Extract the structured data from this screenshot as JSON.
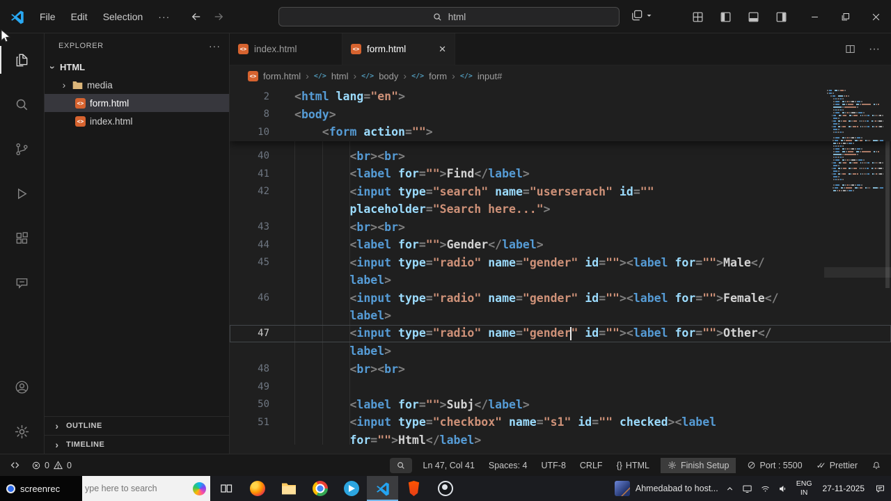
{
  "titlebar": {
    "menus": [
      "File",
      "Edit",
      "Selection"
    ],
    "more": "···",
    "search_value": "html"
  },
  "tabs": {
    "tab1": "index.html",
    "tab2": "form.html"
  },
  "breadcrumb": {
    "file": "form.html",
    "seg1": "html",
    "seg2": "body",
    "seg3": "form",
    "seg4": "input#"
  },
  "explorer": {
    "title": "EXPLORER",
    "more": "···",
    "root": "HTML",
    "folder1": "media",
    "file1": "form.html",
    "file2": "index.html",
    "outline": "OUTLINE",
    "timeline": "TIMELINE"
  },
  "icons": {
    "chevron": "›",
    "more": "···",
    "html_glyph": "<>",
    "braces": "{}",
    "checks": "✓✓"
  },
  "editor": {
    "sticky_rows": [
      {
        "n": "2",
        "t": [
          [
            "p",
            "<"
          ],
          [
            "tag",
            "html"
          ],
          [
            "ws",
            " "
          ],
          [
            "attr",
            "lang"
          ],
          [
            "p",
            "="
          ],
          [
            "str",
            "\"en\""
          ],
          [
            "p",
            ">"
          ]
        ]
      },
      {
        "n": "8",
        "t": [
          [
            "p",
            "<"
          ],
          [
            "tag",
            "body"
          ],
          [
            "p",
            ">"
          ]
        ]
      },
      {
        "n": "10",
        "t": [
          [
            "ws",
            "    "
          ],
          [
            "p",
            "<"
          ],
          [
            "tag",
            "form"
          ],
          [
            "ws",
            " "
          ],
          [
            "attr",
            "action"
          ],
          [
            "p",
            "="
          ],
          [
            "str",
            "\"\""
          ],
          [
            "p",
            ">"
          ]
        ]
      }
    ],
    "rows": [
      {
        "n": "40",
        "t": [
          [
            "ws",
            "        "
          ],
          [
            "p",
            "<"
          ],
          [
            "tag",
            "br"
          ],
          [
            "p",
            "><"
          ],
          [
            "tag",
            "br"
          ],
          [
            "p",
            ">"
          ]
        ]
      },
      {
        "n": "41",
        "t": [
          [
            "ws",
            "        "
          ],
          [
            "p",
            "<"
          ],
          [
            "tag",
            "label"
          ],
          [
            "ws",
            " "
          ],
          [
            "attr",
            "for"
          ],
          [
            "p",
            "="
          ],
          [
            "str",
            "\"\""
          ],
          [
            "p",
            ">"
          ],
          [
            "txt",
            "Find"
          ],
          [
            "p",
            "</"
          ],
          [
            "tag",
            "label"
          ],
          [
            "p",
            ">"
          ]
        ]
      },
      {
        "n": "42",
        "t": [
          [
            "ws",
            "        "
          ],
          [
            "p",
            "<"
          ],
          [
            "tag",
            "input"
          ],
          [
            "ws",
            " "
          ],
          [
            "attr",
            "type"
          ],
          [
            "p",
            "="
          ],
          [
            "str",
            "\"search\""
          ],
          [
            "ws",
            " "
          ],
          [
            "attr",
            "name"
          ],
          [
            "p",
            "="
          ],
          [
            "str",
            "\"userserach\""
          ],
          [
            "ws",
            " "
          ],
          [
            "attr",
            "id"
          ],
          [
            "p",
            "="
          ],
          [
            "str",
            "\"\""
          ]
        ]
      },
      {
        "n": "",
        "t": [
          [
            "ws",
            "        "
          ],
          [
            "attr",
            "placeholder"
          ],
          [
            "p",
            "="
          ],
          [
            "str",
            "\"Search here...\""
          ],
          [
            "p",
            ">"
          ]
        ]
      },
      {
        "n": "43",
        "t": [
          [
            "ws",
            "        "
          ],
          [
            "p",
            "<"
          ],
          [
            "tag",
            "br"
          ],
          [
            "p",
            "><"
          ],
          [
            "tag",
            "br"
          ],
          [
            "p",
            ">"
          ]
        ]
      },
      {
        "n": "44",
        "t": [
          [
            "ws",
            "        "
          ],
          [
            "p",
            "<"
          ],
          [
            "tag",
            "label"
          ],
          [
            "ws",
            " "
          ],
          [
            "attr",
            "for"
          ],
          [
            "p",
            "="
          ],
          [
            "str",
            "\"\""
          ],
          [
            "p",
            ">"
          ],
          [
            "txt",
            "Gender"
          ],
          [
            "p",
            "</"
          ],
          [
            "tag",
            "label"
          ],
          [
            "p",
            ">"
          ]
        ]
      },
      {
        "n": "45",
        "t": [
          [
            "ws",
            "        "
          ],
          [
            "p",
            "<"
          ],
          [
            "tag",
            "input"
          ],
          [
            "ws",
            " "
          ],
          [
            "attr",
            "type"
          ],
          [
            "p",
            "="
          ],
          [
            "str",
            "\"radio\""
          ],
          [
            "ws",
            " "
          ],
          [
            "attr",
            "name"
          ],
          [
            "p",
            "="
          ],
          [
            "str",
            "\"gender\""
          ],
          [
            "ws",
            " "
          ],
          [
            "attr",
            "id"
          ],
          [
            "p",
            "="
          ],
          [
            "str",
            "\"\""
          ],
          [
            "p",
            "><"
          ],
          [
            "tag",
            "label"
          ],
          [
            "ws",
            " "
          ],
          [
            "attr",
            "for"
          ],
          [
            "p",
            "="
          ],
          [
            "str",
            "\"\""
          ],
          [
            "p",
            ">"
          ],
          [
            "txt",
            "Male"
          ],
          [
            "p",
            "</"
          ]
        ]
      },
      {
        "n": "",
        "t": [
          [
            "ws",
            "        "
          ],
          [
            "tag",
            "label"
          ],
          [
            "p",
            ">"
          ]
        ]
      },
      {
        "n": "46",
        "t": [
          [
            "ws",
            "        "
          ],
          [
            "p",
            "<"
          ],
          [
            "tag",
            "input"
          ],
          [
            "ws",
            " "
          ],
          [
            "attr",
            "type"
          ],
          [
            "p",
            "="
          ],
          [
            "str",
            "\"radio\""
          ],
          [
            "ws",
            " "
          ],
          [
            "attr",
            "name"
          ],
          [
            "p",
            "="
          ],
          [
            "str",
            "\"gender\""
          ],
          [
            "ws",
            " "
          ],
          [
            "attr",
            "id"
          ],
          [
            "p",
            "="
          ],
          [
            "str",
            "\"\""
          ],
          [
            "p",
            "><"
          ],
          [
            "tag",
            "label"
          ],
          [
            "ws",
            " "
          ],
          [
            "attr",
            "for"
          ],
          [
            "p",
            "="
          ],
          [
            "str",
            "\"\""
          ],
          [
            "p",
            ">"
          ],
          [
            "txt",
            "Female"
          ],
          [
            "p",
            "</"
          ]
        ]
      },
      {
        "n": "",
        "t": [
          [
            "ws",
            "        "
          ],
          [
            "tag",
            "label"
          ],
          [
            "p",
            ">"
          ]
        ]
      },
      {
        "n": "47",
        "a": 1,
        "t": [
          [
            "ws",
            "        "
          ],
          [
            "p",
            "<"
          ],
          [
            "tag",
            "input"
          ],
          [
            "ws",
            " "
          ],
          [
            "attr",
            "type"
          ],
          [
            "p",
            "="
          ],
          [
            "str",
            "\"radio\""
          ],
          [
            "ws",
            " "
          ],
          [
            "attr",
            "name"
          ],
          [
            "p",
            "="
          ],
          [
            "str",
            "\"gender"
          ],
          [
            "caret",
            ""
          ],
          [
            "str",
            "\""
          ],
          [
            "ws",
            " "
          ],
          [
            "attr",
            "id"
          ],
          [
            "p",
            "="
          ],
          [
            "str",
            "\"\""
          ],
          [
            "p",
            "><"
          ],
          [
            "tag",
            "label"
          ],
          [
            "ws",
            " "
          ],
          [
            "attr",
            "for"
          ],
          [
            "p",
            "="
          ],
          [
            "str",
            "\"\""
          ],
          [
            "p",
            ">"
          ],
          [
            "txt",
            "Other"
          ],
          [
            "p",
            "</"
          ]
        ]
      },
      {
        "n": "",
        "t": [
          [
            "ws",
            "        "
          ],
          [
            "tag",
            "label"
          ],
          [
            "p",
            ">"
          ]
        ]
      },
      {
        "n": "48",
        "t": [
          [
            "ws",
            "        "
          ],
          [
            "p",
            "<"
          ],
          [
            "tag",
            "br"
          ],
          [
            "p",
            "><"
          ],
          [
            "tag",
            "br"
          ],
          [
            "p",
            ">"
          ]
        ]
      },
      {
        "n": "49",
        "t": []
      },
      {
        "n": "50",
        "t": [
          [
            "ws",
            "        "
          ],
          [
            "p",
            "<"
          ],
          [
            "tag",
            "label"
          ],
          [
            "ws",
            " "
          ],
          [
            "attr",
            "for"
          ],
          [
            "p",
            "="
          ],
          [
            "str",
            "\"\""
          ],
          [
            "p",
            ">"
          ],
          [
            "txt",
            "Subj"
          ],
          [
            "p",
            "</"
          ],
          [
            "tag",
            "label"
          ],
          [
            "p",
            ">"
          ]
        ]
      },
      {
        "n": "51",
        "t": [
          [
            "ws",
            "        "
          ],
          [
            "p",
            "<"
          ],
          [
            "tag",
            "input"
          ],
          [
            "ws",
            " "
          ],
          [
            "attr",
            "type"
          ],
          [
            "p",
            "="
          ],
          [
            "str",
            "\"checkbox\""
          ],
          [
            "ws",
            " "
          ],
          [
            "attr",
            "name"
          ],
          [
            "p",
            "="
          ],
          [
            "str",
            "\"s1\""
          ],
          [
            "ws",
            " "
          ],
          [
            "attr",
            "id"
          ],
          [
            "p",
            "="
          ],
          [
            "str",
            "\"\""
          ],
          [
            "ws",
            " "
          ],
          [
            "attr",
            "checked"
          ],
          [
            "p",
            "><"
          ],
          [
            "tag",
            "label"
          ]
        ]
      },
      {
        "n": "",
        "t": [
          [
            "ws",
            "        "
          ],
          [
            "attr",
            "for"
          ],
          [
            "p",
            "="
          ],
          [
            "str",
            "\"\""
          ],
          [
            "p",
            ">"
          ],
          [
            "txt",
            "Html"
          ],
          [
            "p",
            "</"
          ],
          [
            "tag",
            "label"
          ],
          [
            "p",
            ">"
          ]
        ]
      }
    ]
  },
  "status": {
    "errors": "0",
    "warnings": "0",
    "line_col": "Ln 47, Col 41",
    "spaces": "Spaces: 4",
    "encoding": "UTF-8",
    "eol": "CRLF",
    "language": "HTML",
    "setup": "Finish Setup",
    "port": "Port : 5500",
    "formatter": "Prettier"
  },
  "taskbar": {
    "recorder": "screenrec",
    "search_placeholder": "ype here to search",
    "news": "Ahmedabad to host...",
    "lang_top": "ENG",
    "lang_bottom": "IN",
    "date": "27-11-2025"
  }
}
